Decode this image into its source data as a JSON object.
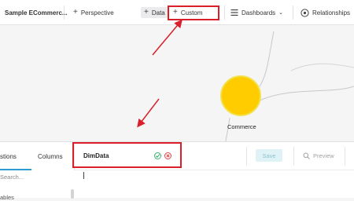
{
  "toolbar": {
    "app_title": "Sample ECommerc...",
    "perspective_label": "Perspective",
    "data_label": "Data",
    "custom_label": "Custom",
    "dashboards_label": "Dashboards",
    "relationships_label": "Relationships"
  },
  "canvas": {
    "node_label": "Commerce",
    "node_color": "#ffcc00"
  },
  "bottom_panel": {
    "tabs": [
      {
        "label": "stions"
      },
      {
        "label": "Columns"
      }
    ],
    "search_placeholder": "Search...",
    "tables_label": "ables",
    "editor_name": "DimData",
    "save_label": "Save",
    "preview_label": "Preview"
  },
  "colors": {
    "accent": "#2f9ad0",
    "annotation_red": "#d9202a",
    "confirm_green": "#37b26c",
    "cancel_red": "#e0434a"
  }
}
